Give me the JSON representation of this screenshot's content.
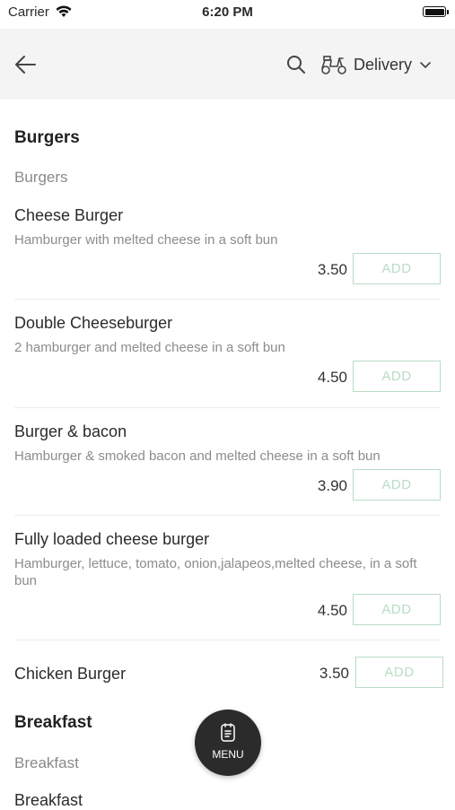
{
  "status_bar": {
    "carrier": "Carrier",
    "time": "6:20 PM"
  },
  "header": {
    "delivery_label": "Delivery"
  },
  "sections": [
    {
      "title": "Burgers",
      "subcategory": "Burgers"
    },
    {
      "title": "Breakfast",
      "subcategory": "Breakfast",
      "next_heading": "Breakfast"
    }
  ],
  "items": [
    {
      "name": "Cheese Burger",
      "description": "Hamburger with melted cheese in a soft bun",
      "price": "3.50",
      "add_label": "ADD"
    },
    {
      "name": "Double Cheeseburger",
      "description": "2 hamburger and melted cheese in a soft bun",
      "price": "4.50",
      "add_label": "ADD"
    },
    {
      "name": "Burger & bacon",
      "description": "Hamburger & smoked bacon and melted cheese in a soft bun",
      "price": "3.90",
      "add_label": "ADD"
    },
    {
      "name": "Fully loaded cheese burger",
      "description": "Hamburger, lettuce, tomato, onion,jalapeos,melted cheese, in a soft bun",
      "price": "4.50",
      "add_label": "ADD"
    },
    {
      "name": "Chicken Burger",
      "description": "",
      "price": "3.50",
      "add_label": "ADD"
    }
  ],
  "fab": {
    "label": "MENU"
  },
  "colors": {
    "accent": "#b9dcc5",
    "fab_bg": "#2b2b2b",
    "header_bg": "#f4f4f4"
  },
  "icons": [
    "back-arrow-icon",
    "search-icon",
    "scooter-icon",
    "chevron-down-icon",
    "menu-icon",
    "wifi-icon",
    "battery-icon"
  ]
}
